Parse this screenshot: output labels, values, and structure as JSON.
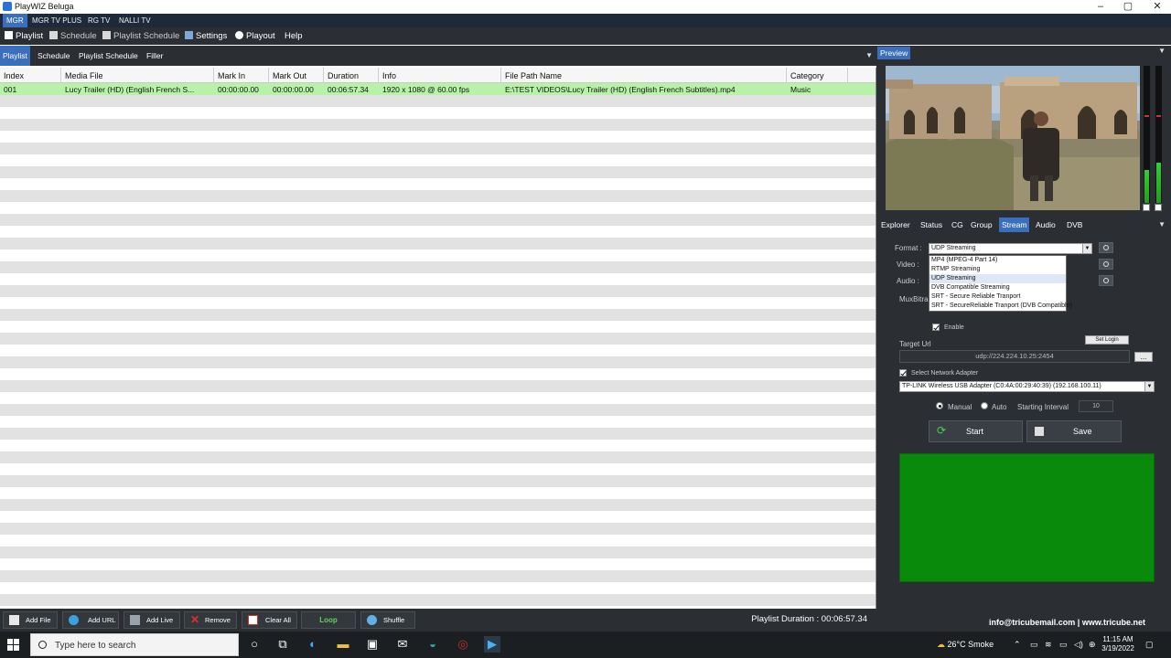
{
  "window": {
    "title": "PlayWIZ Beluga"
  },
  "channels": [
    "MGR",
    "MGR TV PLUS",
    "RG TV",
    "NALLI TV"
  ],
  "menu": {
    "items": [
      {
        "label": "Playlist"
      },
      {
        "label": "Schedule"
      },
      {
        "label": "Playlist Schedule"
      },
      {
        "label": "Settings"
      },
      {
        "label": "Playout"
      },
      {
        "label": "Help"
      }
    ]
  },
  "left_tabs": [
    "Playlist",
    "Schedule",
    "Playlist Schedule",
    "Filler"
  ],
  "grid": {
    "columns": [
      "Index",
      "Media File",
      "Mark In",
      "Mark Out",
      "Duration",
      "Info",
      "File Path Name",
      "Category"
    ],
    "rows": [
      {
        "index": "001",
        "media_file": "Lucy Trailer (HD) (English French S...",
        "mark_in": "00:00:00.00",
        "mark_out": "00:00:00.00",
        "duration": "00:06:57.34",
        "info": "1920 x 1080 @ 60.00 fps",
        "file_path": "E:\\TEST VIDEOS\\Lucy Trailer (HD) (English French Subtitles).mp4",
        "category": "Music"
      }
    ]
  },
  "bottom_toolbar": {
    "buttons": [
      "Add File",
      "Add URL",
      "Add Live",
      "Remove",
      "Clear All",
      "Loop",
      "Shuffle"
    ],
    "duration_label": "Playlist Duration : 00:06:57.34"
  },
  "preview": {
    "tab": "Preview"
  },
  "stream_tabs": [
    "Explorer",
    "Status",
    "CG",
    "Group",
    "Stream",
    "Audio",
    "DVB"
  ],
  "stream": {
    "format_label": "Format :",
    "format_value": "UDP Streaming",
    "video_label": "Video :",
    "audio_label": "Audio :",
    "mux_label": "MuxBitra",
    "format_options": [
      "MP4 (MPEG-4 Part 14)",
      "RTMP Streaming",
      "UDP Streaming",
      "DVB Compatible Streaming",
      "SRT - Secure Reliable Tranport",
      "SRT - SecureReliable Tranport (DVB Compatible)"
    ],
    "enable_label": "Enable",
    "set_login_label": "Set Login",
    "target_url_label": "Target Url",
    "target_url_value": "udp://224.224.10.25:2454",
    "browse_label": "...",
    "select_adapter_label": "Select Network Adapter",
    "adapter_value": "TP-LINK Wireless USB Adapter (C0:4A:00:29:40:39) (192.168.100.11)",
    "manual_label": "Manual",
    "auto_label": "Auto",
    "interval_label": "Starting Interval",
    "interval_value": "10",
    "start_label": "Start",
    "save_label": "Save",
    "footer": "info@tricubemail.com | www.tricube.net"
  },
  "taskbar": {
    "search_placeholder": "Type here to search",
    "weather": "26°C  Smoke",
    "time": "11:15 AM",
    "date": "3/19/2022"
  },
  "colors": {
    "accent": "#3a6fbd",
    "panel": "#2b2f33",
    "selected_row": "#b8f2a8",
    "output_box": "#0a8a0a",
    "loop_text": "#5cd65c"
  }
}
